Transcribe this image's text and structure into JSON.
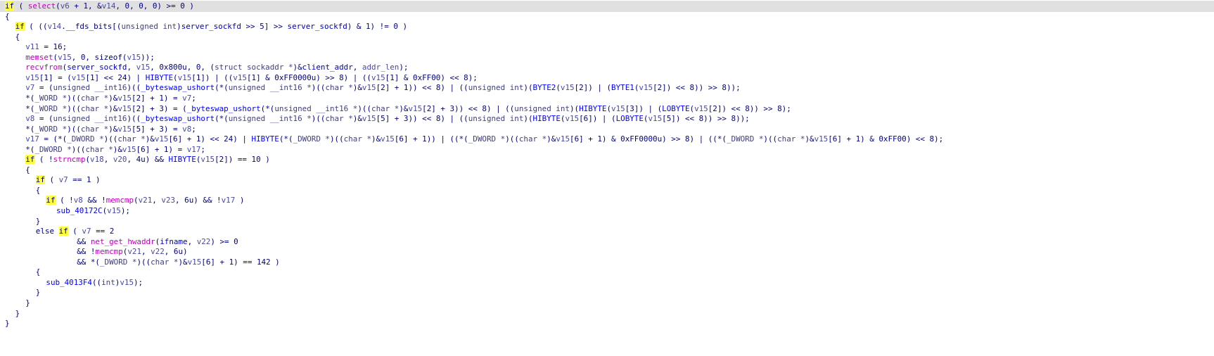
{
  "editor": {
    "highlight_color": "#ffff40",
    "current_line_color": "#e0e0e0",
    "lines": [
      {
        "indent": 0,
        "current": true,
        "tokens": [
          {
            "t": "if",
            "k": "kw",
            "hl": true
          },
          {
            "t": " ( "
          },
          {
            "t": "select",
            "k": "fn"
          },
          {
            "t": "("
          },
          {
            "t": "v6",
            "k": "var"
          },
          {
            "t": " + 1, &"
          },
          {
            "t": "v14",
            "k": "var"
          },
          {
            "t": ", 0, 0, 0) >= 0 )"
          }
        ]
      },
      {
        "indent": 0,
        "tokens": [
          {
            "t": "{"
          }
        ]
      },
      {
        "indent": 1,
        "tokens": [
          {
            "t": "if",
            "k": "kw",
            "hl": true
          },
          {
            "t": " ( (("
          },
          {
            "t": "v14",
            "k": "var"
          },
          {
            "t": ".__fds_bits[("
          },
          {
            "t": "unsigned int",
            "k": "type"
          },
          {
            "t": ")"
          },
          {
            "t": "server_sockfd",
            "k": "glob"
          },
          {
            "t": " >> 5] >> "
          },
          {
            "t": "server_sockfd",
            "k": "glob"
          },
          {
            "t": ") & 1) != 0 )"
          }
        ]
      },
      {
        "indent": 1,
        "tokens": [
          {
            "t": "{"
          }
        ]
      },
      {
        "indent": 2,
        "tokens": [
          {
            "t": "v11",
            "k": "var"
          },
          {
            "t": " = 16;"
          }
        ]
      },
      {
        "indent": 2,
        "tokens": [
          {
            "t": "memset",
            "k": "fn"
          },
          {
            "t": "("
          },
          {
            "t": "v15",
            "k": "var"
          },
          {
            "t": ", 0, sizeof("
          },
          {
            "t": "v15",
            "k": "var"
          },
          {
            "t": "));"
          }
        ]
      },
      {
        "indent": 2,
        "tokens": [
          {
            "t": "recvfrom",
            "k": "fn"
          },
          {
            "t": "("
          },
          {
            "t": "server_sockfd",
            "k": "glob"
          },
          {
            "t": ", "
          },
          {
            "t": "v15",
            "k": "var"
          },
          {
            "t": ", 0x800u, 0, ("
          },
          {
            "t": "struct sockaddr *",
            "k": "type"
          },
          {
            "t": ")&"
          },
          {
            "t": "client_addr",
            "k": "glob"
          },
          {
            "t": ", "
          },
          {
            "t": "addr_len",
            "k": "var"
          },
          {
            "t": ");"
          }
        ]
      },
      {
        "indent": 2,
        "tokens": [
          {
            "t": "v15",
            "k": "var"
          },
          {
            "t": "[1] = ("
          },
          {
            "t": "v15",
            "k": "var"
          },
          {
            "t": "[1] << 24) | "
          },
          {
            "t": "HIBYTE",
            "k": "api"
          },
          {
            "t": "("
          },
          {
            "t": "v15",
            "k": "var"
          },
          {
            "t": "[1]) | (("
          },
          {
            "t": "v15",
            "k": "var"
          },
          {
            "t": "[1] & 0xFF0000u) >> 8) | (("
          },
          {
            "t": "v15",
            "k": "var"
          },
          {
            "t": "[1] & 0xFF00) << 8);"
          }
        ]
      },
      {
        "indent": 2,
        "tokens": [
          {
            "t": "v7",
            "k": "var"
          },
          {
            "t": " = ("
          },
          {
            "t": "unsigned __int16",
            "k": "type"
          },
          {
            "t": ")(("
          },
          {
            "t": "_byteswap_ushort",
            "k": "api"
          },
          {
            "t": "(*("
          },
          {
            "t": "unsigned __int16 *",
            "k": "type"
          },
          {
            "t": ")(("
          },
          {
            "t": "char *",
            "k": "type"
          },
          {
            "t": ")&"
          },
          {
            "t": "v15",
            "k": "var"
          },
          {
            "t": "[2] + 1)) << 8) | (("
          },
          {
            "t": "unsigned int",
            "k": "type"
          },
          {
            "t": ")("
          },
          {
            "t": "BYTE2",
            "k": "api"
          },
          {
            "t": "("
          },
          {
            "t": "v15",
            "k": "var"
          },
          {
            "t": "[2]) | ("
          },
          {
            "t": "BYTE1",
            "k": "api"
          },
          {
            "t": "("
          },
          {
            "t": "v15",
            "k": "var"
          },
          {
            "t": "[2]) << 8)) >> 8));"
          }
        ]
      },
      {
        "indent": 2,
        "tokens": [
          {
            "t": "*("
          },
          {
            "t": "_WORD *",
            "k": "type"
          },
          {
            "t": ")(("
          },
          {
            "t": "char *",
            "k": "type"
          },
          {
            "t": ")&"
          },
          {
            "t": "v15",
            "k": "var"
          },
          {
            "t": "[2] + 1) = "
          },
          {
            "t": "v7",
            "k": "var"
          },
          {
            "t": ";"
          }
        ]
      },
      {
        "indent": 2,
        "tokens": [
          {
            "t": "*("
          },
          {
            "t": "_WORD *",
            "k": "type"
          },
          {
            "t": ")(("
          },
          {
            "t": "char *",
            "k": "type"
          },
          {
            "t": ")&"
          },
          {
            "t": "v15",
            "k": "var"
          },
          {
            "t": "[2] + 3) = ("
          },
          {
            "t": "_byteswap_ushort",
            "k": "api"
          },
          {
            "t": "(*("
          },
          {
            "t": "unsigned __int16 *",
            "k": "type"
          },
          {
            "t": ")(("
          },
          {
            "t": "char *",
            "k": "type"
          },
          {
            "t": ")&"
          },
          {
            "t": "v15",
            "k": "var"
          },
          {
            "t": "[2] + 3)) << 8) | (("
          },
          {
            "t": "unsigned int",
            "k": "type"
          },
          {
            "t": ")("
          },
          {
            "t": "HIBYTE",
            "k": "api"
          },
          {
            "t": "("
          },
          {
            "t": "v15",
            "k": "var"
          },
          {
            "t": "[3]) | ("
          },
          {
            "t": "LOBYTE",
            "k": "api"
          },
          {
            "t": "("
          },
          {
            "t": "v15",
            "k": "var"
          },
          {
            "t": "[2]) << 8)) >> 8);"
          }
        ]
      },
      {
        "indent": 2,
        "tokens": [
          {
            "t": "v8",
            "k": "var"
          },
          {
            "t": " = ("
          },
          {
            "t": "unsigned __int16",
            "k": "type"
          },
          {
            "t": ")(("
          },
          {
            "t": "_byteswap_ushort",
            "k": "api"
          },
          {
            "t": "(*("
          },
          {
            "t": "unsigned __int16 *",
            "k": "type"
          },
          {
            "t": ")(("
          },
          {
            "t": "char *",
            "k": "type"
          },
          {
            "t": ")&"
          },
          {
            "t": "v15",
            "k": "var"
          },
          {
            "t": "[5] + 3)) << 8) | (("
          },
          {
            "t": "unsigned int",
            "k": "type"
          },
          {
            "t": ")("
          },
          {
            "t": "HIBYTE",
            "k": "api"
          },
          {
            "t": "("
          },
          {
            "t": "v15",
            "k": "var"
          },
          {
            "t": "[6]) | ("
          },
          {
            "t": "LOBYTE",
            "k": "api"
          },
          {
            "t": "("
          },
          {
            "t": "v15",
            "k": "var"
          },
          {
            "t": "[5]) << 8)) >> 8));"
          }
        ]
      },
      {
        "indent": 2,
        "tokens": [
          {
            "t": "*("
          },
          {
            "t": "_WORD *",
            "k": "type"
          },
          {
            "t": ")(("
          },
          {
            "t": "char *",
            "k": "type"
          },
          {
            "t": ")&"
          },
          {
            "t": "v15",
            "k": "var"
          },
          {
            "t": "[5] + 3) = "
          },
          {
            "t": "v8",
            "k": "var"
          },
          {
            "t": ";"
          }
        ]
      },
      {
        "indent": 2,
        "tokens": [
          {
            "t": "v17",
            "k": "var"
          },
          {
            "t": " = (*("
          },
          {
            "t": "_DWORD *",
            "k": "type"
          },
          {
            "t": ")(("
          },
          {
            "t": "char *",
            "k": "type"
          },
          {
            "t": ")&"
          },
          {
            "t": "v15",
            "k": "var"
          },
          {
            "t": "[6] + 1) << 24) | "
          },
          {
            "t": "HIBYTE",
            "k": "api"
          },
          {
            "t": "(*("
          },
          {
            "t": "_DWORD *",
            "k": "type"
          },
          {
            "t": ")(("
          },
          {
            "t": "char *",
            "k": "type"
          },
          {
            "t": ")&"
          },
          {
            "t": "v15",
            "k": "var"
          },
          {
            "t": "[6] + 1)) | ((*("
          },
          {
            "t": "_DWORD *",
            "k": "type"
          },
          {
            "t": ")(("
          },
          {
            "t": "char *",
            "k": "type"
          },
          {
            "t": ")&"
          },
          {
            "t": "v15",
            "k": "var"
          },
          {
            "t": "[6] + 1) & 0xFF0000u) >> 8) | ((*("
          },
          {
            "t": "_DWORD *",
            "k": "type"
          },
          {
            "t": ")(("
          },
          {
            "t": "char *",
            "k": "type"
          },
          {
            "t": ")&"
          },
          {
            "t": "v15",
            "k": "var"
          },
          {
            "t": "[6] + 1) & 0xFF00) << 8);"
          }
        ]
      },
      {
        "indent": 2,
        "tokens": [
          {
            "t": "*("
          },
          {
            "t": "_DWORD *",
            "k": "type"
          },
          {
            "t": ")(("
          },
          {
            "t": "char *",
            "k": "type"
          },
          {
            "t": ")&"
          },
          {
            "t": "v15",
            "k": "var"
          },
          {
            "t": "[6] + 1) = "
          },
          {
            "t": "v17",
            "k": "var"
          },
          {
            "t": ";"
          }
        ]
      },
      {
        "indent": 2,
        "tokens": [
          {
            "t": "if",
            "k": "kw",
            "hl": true
          },
          {
            "t": " ( !"
          },
          {
            "t": "strncmp",
            "k": "fn"
          },
          {
            "t": "("
          },
          {
            "t": "v18",
            "k": "var"
          },
          {
            "t": ", "
          },
          {
            "t": "v20",
            "k": "var"
          },
          {
            "t": ", 4u) && "
          },
          {
            "t": "HIBYTE",
            "k": "api"
          },
          {
            "t": "("
          },
          {
            "t": "v15",
            "k": "var"
          },
          {
            "t": "[2]) == 10 )"
          }
        ]
      },
      {
        "indent": 2,
        "tokens": [
          {
            "t": "{"
          }
        ]
      },
      {
        "indent": 3,
        "tokens": [
          {
            "t": "if",
            "k": "kw",
            "hl": true
          },
          {
            "t": " ( "
          },
          {
            "t": "v7",
            "k": "var"
          },
          {
            "t": " == 1 )"
          }
        ]
      },
      {
        "indent": 3,
        "tokens": [
          {
            "t": "{"
          }
        ]
      },
      {
        "indent": 4,
        "tokens": [
          {
            "t": "if",
            "k": "kw",
            "hl": true
          },
          {
            "t": " ( !"
          },
          {
            "t": "v8",
            "k": "var"
          },
          {
            "t": " && !"
          },
          {
            "t": "memcmp",
            "k": "fn"
          },
          {
            "t": "("
          },
          {
            "t": "v21",
            "k": "var"
          },
          {
            "t": ", "
          },
          {
            "t": "v23",
            "k": "var"
          },
          {
            "t": ", 6u) && !"
          },
          {
            "t": "v17",
            "k": "var"
          },
          {
            "t": " )"
          }
        ]
      },
      {
        "indent": 5,
        "tokens": [
          {
            "t": "sub_40172C",
            "k": "api"
          },
          {
            "t": "("
          },
          {
            "t": "v15",
            "k": "var"
          },
          {
            "t": ");"
          }
        ]
      },
      {
        "indent": 3,
        "tokens": [
          {
            "t": "}"
          }
        ]
      },
      {
        "indent": 3,
        "tokens": [
          {
            "t": "else "
          },
          {
            "t": "if",
            "k": "kw",
            "hl": true
          },
          {
            "t": " ( "
          },
          {
            "t": "v7",
            "k": "var"
          },
          {
            "t": " == 2"
          }
        ]
      },
      {
        "indent": 7,
        "tokens": [
          {
            "t": "&& "
          },
          {
            "t": "net_get_hwaddr",
            "k": "fn"
          },
          {
            "t": "("
          },
          {
            "t": "ifname",
            "k": "glob"
          },
          {
            "t": ", "
          },
          {
            "t": "v22",
            "k": "var"
          },
          {
            "t": ") >= 0"
          }
        ]
      },
      {
        "indent": 7,
        "tokens": [
          {
            "t": "&& !"
          },
          {
            "t": "memcmp",
            "k": "fn"
          },
          {
            "t": "("
          },
          {
            "t": "v21",
            "k": "var"
          },
          {
            "t": ", "
          },
          {
            "t": "v22",
            "k": "var"
          },
          {
            "t": ", 6u)"
          }
        ]
      },
      {
        "indent": 7,
        "tokens": [
          {
            "t": "&& *("
          },
          {
            "t": "_DWORD *",
            "k": "type"
          },
          {
            "t": ")(("
          },
          {
            "t": "char *",
            "k": "type"
          },
          {
            "t": ")&"
          },
          {
            "t": "v15",
            "k": "var"
          },
          {
            "t": "[6] + 1) == 142 )"
          }
        ]
      },
      {
        "indent": 3,
        "tokens": [
          {
            "t": "{"
          }
        ]
      },
      {
        "indent": 4,
        "tokens": [
          {
            "t": "sub_4013F4",
            "k": "api"
          },
          {
            "t": "(("
          },
          {
            "t": "int",
            "k": "type"
          },
          {
            "t": ")"
          },
          {
            "t": "v15",
            "k": "var"
          },
          {
            "t": ");"
          }
        ]
      },
      {
        "indent": 3,
        "tokens": [
          {
            "t": "}"
          }
        ]
      },
      {
        "indent": 2,
        "tokens": [
          {
            "t": "}"
          }
        ]
      },
      {
        "indent": 1,
        "tokens": [
          {
            "t": "}"
          }
        ]
      },
      {
        "indent": 0,
        "tokens": [
          {
            "t": "}"
          }
        ]
      }
    ]
  }
}
